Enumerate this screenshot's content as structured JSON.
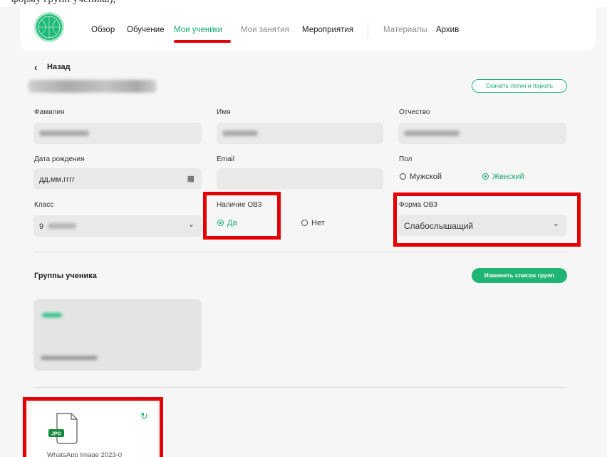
{
  "top_cut_text": "форму групп ученика),",
  "nav": {
    "items": [
      {
        "label": "Обзор"
      },
      {
        "label": "Обучение"
      },
      {
        "label": "Мои ученики"
      },
      {
        "label": "Мои занятия"
      },
      {
        "label": "Мероприятия"
      },
      {
        "label": "Материалы"
      },
      {
        "label": "Архив"
      }
    ],
    "active_index": 2,
    "logo_alt": "Билет в будущее"
  },
  "back_label": "Назад",
  "download_button": "Скачать логин и пароль",
  "form": {
    "surname_label": "Фамилия",
    "name_label": "Имя",
    "patronymic_label": "Отчество",
    "birthdate_label": "Дата рождения",
    "birthdate_placeholder": "дд.мм.гггг",
    "email_label": "Email",
    "gender_label": "Пол",
    "gender_options": [
      "Мужской",
      "Женский"
    ],
    "gender_selected": "Женский",
    "class_label": "Класс",
    "class_value": "9",
    "ovz_label": "Наличие ОВЗ",
    "ovz_options": [
      "Да",
      "Нет"
    ],
    "ovz_selected": "Да",
    "ovz_form_label": "Форма ОВЗ",
    "ovz_form_value": "Слабослышащий"
  },
  "groups": {
    "title": "Группы ученика",
    "edit_button": "Изменить список групп"
  },
  "file": {
    "type": "JPG",
    "name": "WhatsApp Image 2023-0"
  },
  "colors": {
    "accent": "#14a86a",
    "highlight": "#e40000"
  }
}
